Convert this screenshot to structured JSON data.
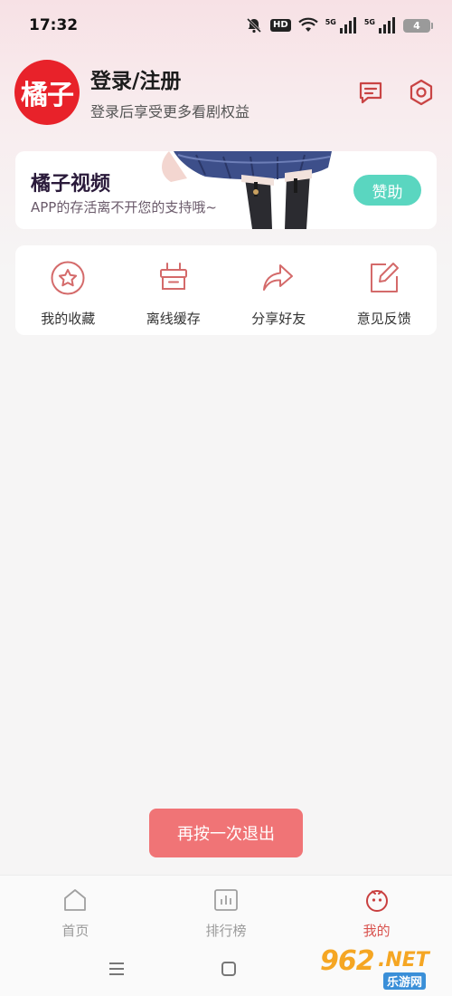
{
  "status_bar": {
    "time": "17:32",
    "hd_label": "HD",
    "signal_1_label": "5G",
    "signal_2_label": "5G",
    "battery_level": "4"
  },
  "profile": {
    "avatar_text": "橘子",
    "title": "登录/注册",
    "subtitle": "登录后享受更多看剧权益",
    "icons": [
      "message-icon",
      "settings-icon"
    ]
  },
  "sponsor": {
    "title": "橘子视频",
    "subtitle": "APP的存活离不开您的支持哦~",
    "button_label": "赞助"
  },
  "shortcuts": [
    {
      "label": "我的收藏",
      "icon": "star-icon"
    },
    {
      "label": "离线缓存",
      "icon": "cache-box-icon"
    },
    {
      "label": "分享好友",
      "icon": "share-arrow-icon"
    },
    {
      "label": "意见反馈",
      "icon": "edit-icon"
    }
  ],
  "toast": {
    "text": "再按一次退出"
  },
  "bottom_nav": [
    {
      "label": "首页",
      "icon": "home-icon",
      "active": false
    },
    {
      "label": "排行榜",
      "icon": "chart-icon",
      "active": false
    },
    {
      "label": "我的",
      "icon": "mine-face-icon",
      "active": true
    }
  ],
  "watermark": {
    "number": "962",
    "suffix": ".NET",
    "sub": "乐游网"
  },
  "colors": {
    "accent_red": "#e8222a",
    "icon_red": "#d9534f",
    "sponsor_button": "#5ad6c0",
    "toast": "#f07476"
  }
}
